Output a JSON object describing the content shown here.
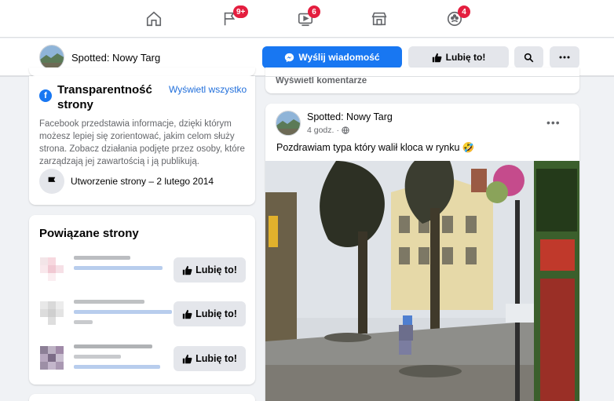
{
  "nav": {
    "tabs": [
      {
        "name": "home",
        "badge": ""
      },
      {
        "name": "pages",
        "badge": "9+"
      },
      {
        "name": "watch",
        "badge": "6"
      },
      {
        "name": "marketplace",
        "badge": ""
      },
      {
        "name": "groups",
        "badge": "4"
      }
    ]
  },
  "page": {
    "name": "Spotted: Nowy Targ",
    "send_message_label": "Wyślij wiadomość",
    "like_label": "Lubię to!"
  },
  "prev_post": {
    "view_comments": "Wyświetl komentarze"
  },
  "transparency": {
    "title": "Transparentność strony",
    "view_all": "Wyświetl wszystko",
    "description": "Facebook przedstawia informacje, dzięki którym możesz lepiej się zorientować, jakim celom służy strona. Zobacz działania podjęte przez osoby, które zarządzają jej zawartością i ją publikują.",
    "created": "Utworzenie strony – 2 lutego 2014"
  },
  "related": {
    "title": "Powiązane strony",
    "items": [
      {
        "like_label": "Lubię to!"
      },
      {
        "like_label": "Lubię to!"
      },
      {
        "like_label": "Lubię to!"
      }
    ]
  },
  "post": {
    "author": "Spotted: Nowy Targ",
    "time": "4 godz.",
    "text": "Pozdrawiam typa który walił kloca w rynku 🤣"
  },
  "colors": {
    "accent": "#1877f2",
    "badge": "#e41e3f",
    "link": "#216fdb"
  }
}
